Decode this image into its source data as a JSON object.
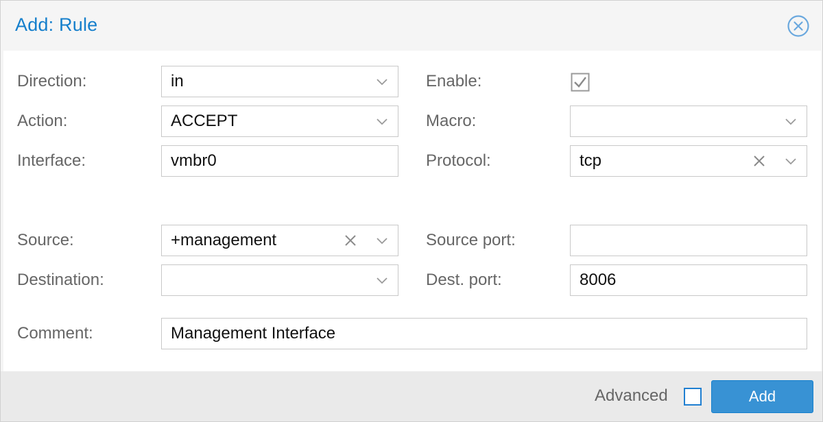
{
  "dialog": {
    "title": "Add: Rule"
  },
  "form": {
    "direction": {
      "label": "Direction:",
      "value": "in"
    },
    "action": {
      "label": "Action:",
      "value": "ACCEPT"
    },
    "interface": {
      "label": "Interface:",
      "value": "vmbr0"
    },
    "enable": {
      "label": "Enable:",
      "checked": true
    },
    "macro": {
      "label": "Macro:",
      "value": ""
    },
    "protocol": {
      "label": "Protocol:",
      "value": "tcp"
    },
    "source": {
      "label": "Source:",
      "value": "+management"
    },
    "destination": {
      "label": "Destination:",
      "value": ""
    },
    "source_port": {
      "label": "Source port:",
      "value": ""
    },
    "dest_port": {
      "label": "Dest. port:",
      "value": "8006"
    },
    "comment": {
      "label": "Comment:",
      "value": "Management Interface"
    }
  },
  "footer": {
    "advanced_label": "Advanced",
    "advanced_checked": false,
    "add_label": "Add"
  },
  "icons": {
    "close": "close-circle-icon",
    "dropdown": "chevron-down-icon",
    "clear": "clear-x-icon",
    "check": "checkbox-checked-icon"
  },
  "colors": {
    "accent": "#157fcc",
    "button": "#3892d4",
    "label": "#666666"
  }
}
